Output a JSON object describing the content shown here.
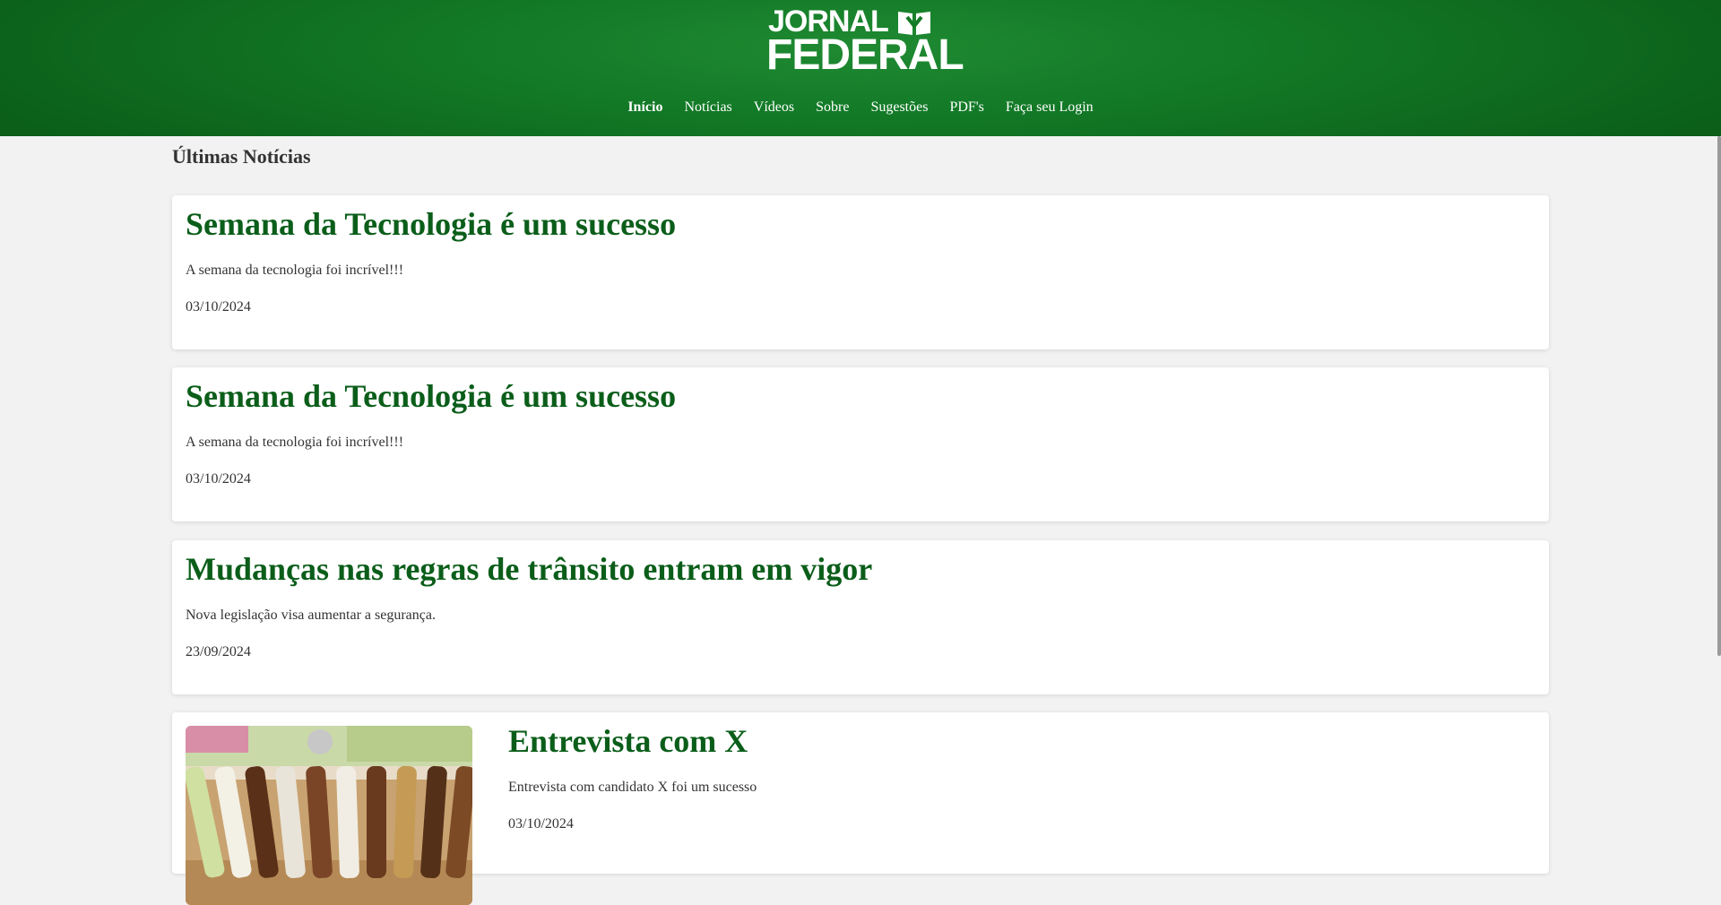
{
  "header": {
    "logo": {
      "line1": "JORNAL",
      "line2": "FEDERAL"
    },
    "nav": [
      {
        "label": "Início"
      },
      {
        "label": "Notícias"
      },
      {
        "label": "Vídeos"
      },
      {
        "label": "Sobre"
      },
      {
        "label": "Sugestões"
      },
      {
        "label": "PDF's"
      },
      {
        "label": "Faça seu Login"
      }
    ]
  },
  "main": {
    "section_title": "Últimas Notícias",
    "articles": [
      {
        "title": "Semana da Tecnologia é um sucesso",
        "summary": "A semana da tecnologia foi incrível!!!",
        "date": "03/10/2024"
      },
      {
        "title": "Semana da Tecnologia é um sucesso",
        "summary": "A semana da tecnologia foi incrível!!!",
        "date": "03/10/2024"
      },
      {
        "title": "Mudanças nas regras de trânsito entram em vigor",
        "summary": "Nova legislação visa aumentar a segurança.",
        "date": "23/09/2024"
      },
      {
        "title": "Entrevista com X",
        "summary": "Entrevista com candidato X foi um sucesso",
        "date": "03/10/2024"
      }
    ]
  },
  "colors": {
    "header_green": "#137a27",
    "title_green": "#0b5e1a",
    "background": "#f2f2f2"
  },
  "icons": [
    "book-icon"
  ]
}
